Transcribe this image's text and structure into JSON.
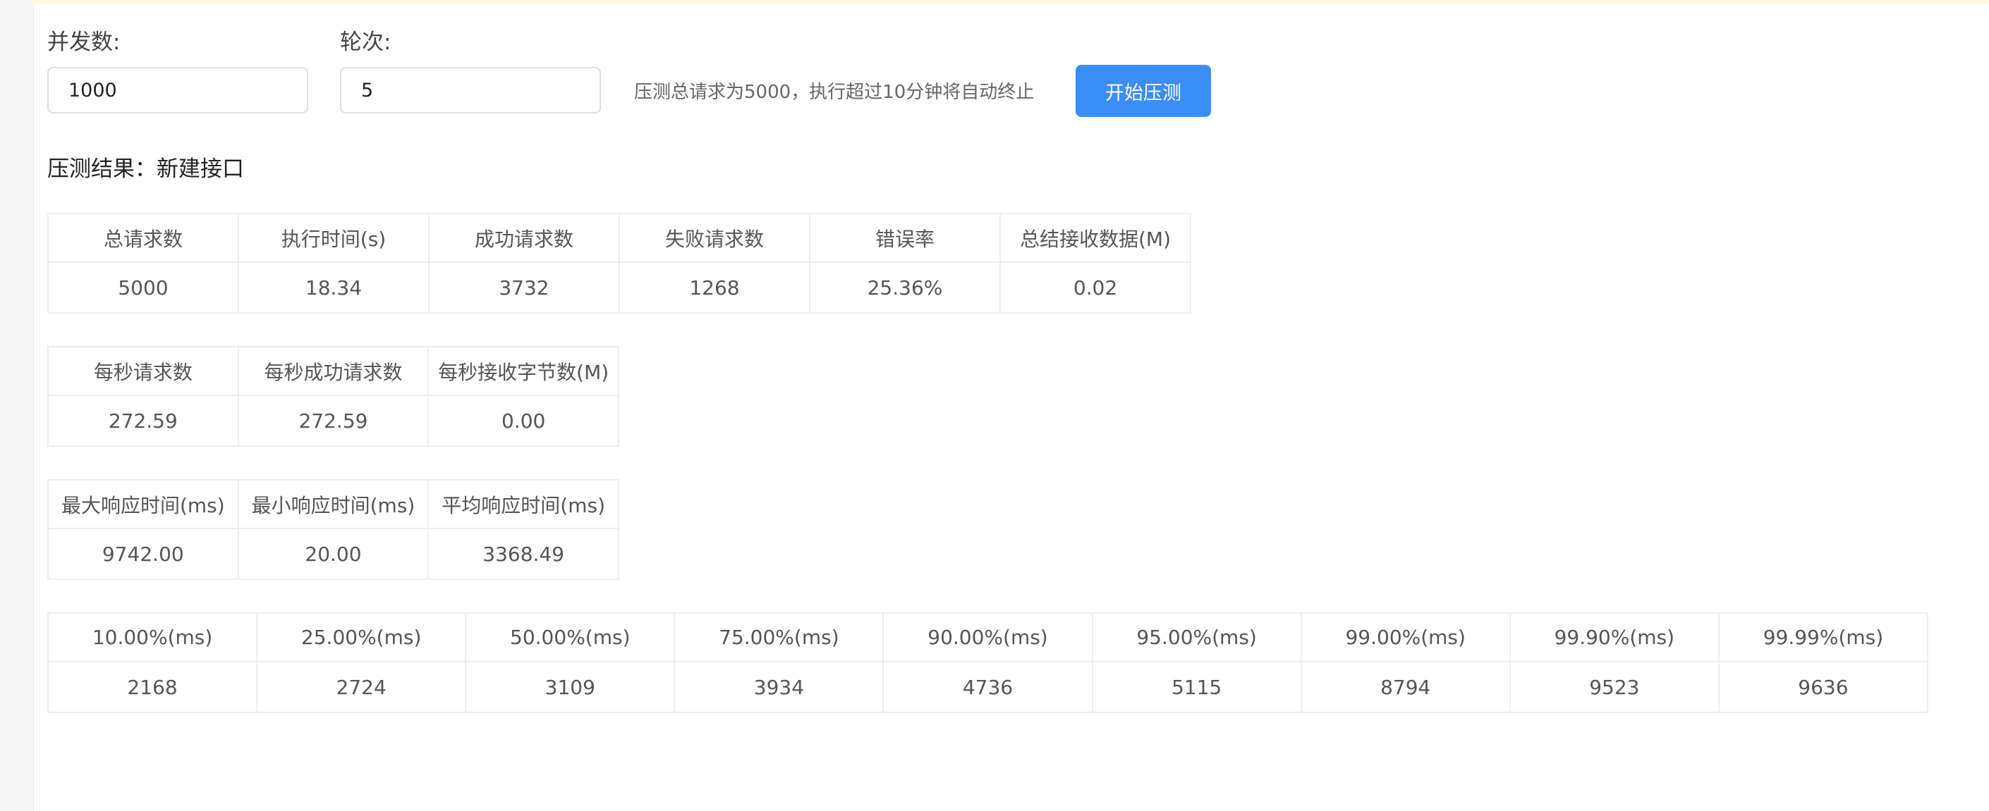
{
  "form": {
    "concurrency_label": "并发数:",
    "concurrency_value": "1000",
    "rounds_label": "轮次:",
    "rounds_value": "5",
    "hint": "压测总请求为5000，执行超过10分钟将自动终止",
    "start_label": "开始压测"
  },
  "result": {
    "title": "压测结果：新建接口"
  },
  "summary_table": {
    "headers": [
      "总请求数",
      "执行时间(s)",
      "成功请求数",
      "失败请求数",
      "错误率",
      "总结接收数据(M)"
    ],
    "values": [
      "5000",
      "18.34",
      "3732",
      "1268",
      "25.36%",
      "0.02"
    ]
  },
  "per_second_table": {
    "headers": [
      "每秒请求数",
      "每秒成功请求数",
      "每秒接收字节数(M)"
    ],
    "values": [
      "272.59",
      "272.59",
      "0.00"
    ]
  },
  "response_time_table": {
    "headers": [
      "最大响应时间(ms)",
      "最小响应时间(ms)",
      "平均响应时间(ms)"
    ],
    "values": [
      "9742.00",
      "20.00",
      "3368.49"
    ]
  },
  "percentile_table": {
    "headers": [
      "10.00%(ms)",
      "25.00%(ms)",
      "50.00%(ms)",
      "75.00%(ms)",
      "90.00%(ms)",
      "95.00%(ms)",
      "99.00%(ms)",
      "99.90%(ms)",
      "99.99%(ms)"
    ],
    "values": [
      "2168",
      "2724",
      "3109",
      "3934",
      "4736",
      "5115",
      "8794",
      "9523",
      "9636"
    ]
  },
  "colors": {
    "primary": "#3a8ef6",
    "border": "#ebeef5",
    "notice_strip": "#fff8e1"
  }
}
